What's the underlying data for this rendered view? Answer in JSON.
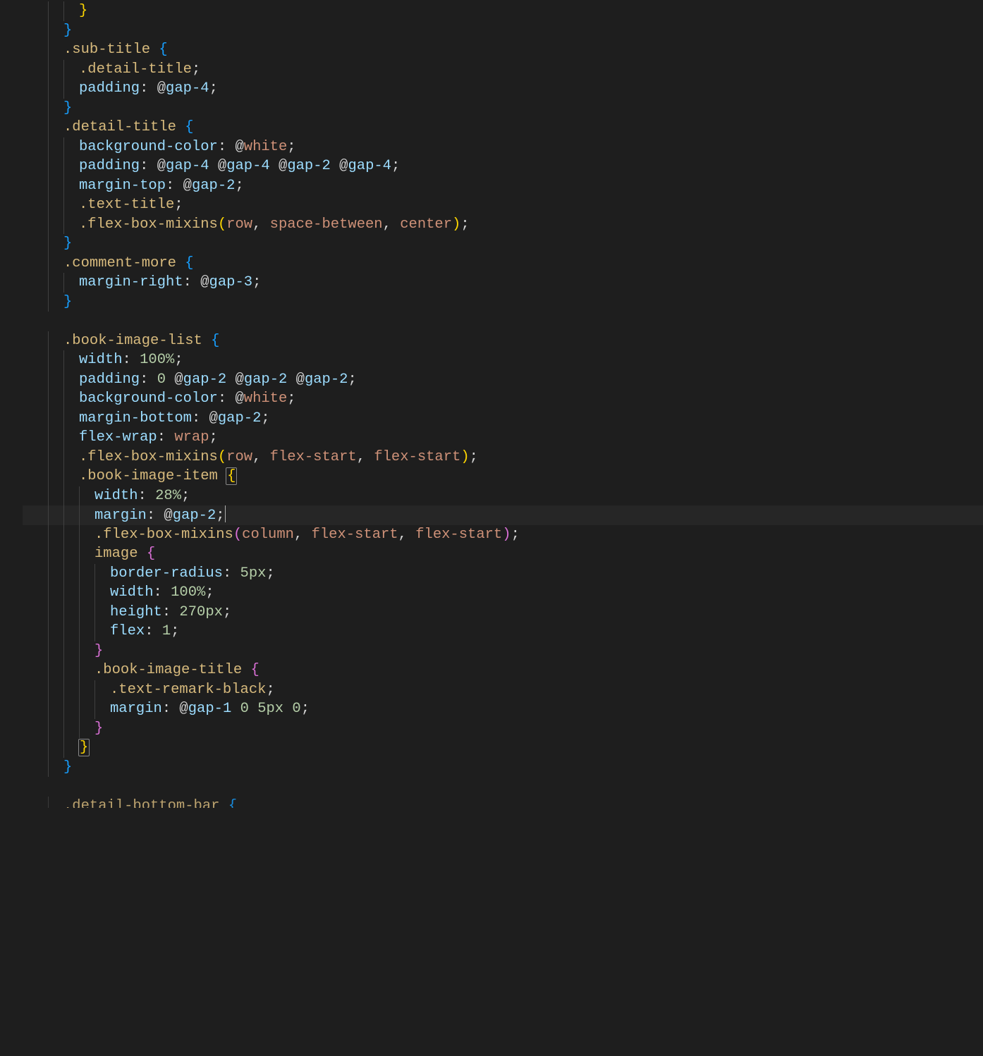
{
  "editor": {
    "theme": "dark",
    "language": "less",
    "visible_line_count": 42,
    "active_line_index": 26,
    "gutter_start_partial": true,
    "indent_size": 2,
    "indent_guides": true,
    "lines": [
      {
        "indent": 3,
        "tokens": [
          {
            "t": "brace3",
            "v": "}"
          }
        ]
      },
      {
        "indent": 2,
        "tokens": [
          {
            "t": "brace2",
            "v": "}"
          }
        ]
      },
      {
        "indent": 2,
        "tokens": [
          {
            "t": "sel",
            "v": ".sub-title"
          },
          {
            "t": "punct",
            "v": " "
          },
          {
            "t": "brace2",
            "v": "{"
          }
        ]
      },
      {
        "indent": 3,
        "tokens": [
          {
            "t": "sel",
            "v": ".detail-title"
          },
          {
            "t": "punct",
            "v": ";"
          }
        ]
      },
      {
        "indent": 3,
        "tokens": [
          {
            "t": "prop",
            "v": "padding"
          },
          {
            "t": "punct",
            "v": ": "
          },
          {
            "t": "at",
            "v": "@"
          },
          {
            "t": "var",
            "v": "gap-4"
          },
          {
            "t": "punct",
            "v": ";"
          }
        ]
      },
      {
        "indent": 2,
        "tokens": [
          {
            "t": "brace2",
            "v": "}"
          }
        ]
      },
      {
        "indent": 2,
        "tokens": [
          {
            "t": "sel",
            "v": ".detail-title"
          },
          {
            "t": "punct",
            "v": " "
          },
          {
            "t": "brace2",
            "v": "{"
          }
        ]
      },
      {
        "indent": 3,
        "tokens": [
          {
            "t": "prop",
            "v": "background-color"
          },
          {
            "t": "punct",
            "v": ": "
          },
          {
            "t": "at",
            "v": "@"
          },
          {
            "t": "white",
            "v": "white"
          },
          {
            "t": "punct",
            "v": ";"
          }
        ]
      },
      {
        "indent": 3,
        "tokens": [
          {
            "t": "prop",
            "v": "padding"
          },
          {
            "t": "punct",
            "v": ": "
          },
          {
            "t": "at",
            "v": "@"
          },
          {
            "t": "var",
            "v": "gap-4"
          },
          {
            "t": "punct",
            "v": " "
          },
          {
            "t": "at",
            "v": "@"
          },
          {
            "t": "var",
            "v": "gap-4"
          },
          {
            "t": "punct",
            "v": " "
          },
          {
            "t": "at",
            "v": "@"
          },
          {
            "t": "var",
            "v": "gap-2"
          },
          {
            "t": "punct",
            "v": " "
          },
          {
            "t": "at",
            "v": "@"
          },
          {
            "t": "var",
            "v": "gap-4"
          },
          {
            "t": "punct",
            "v": ";"
          }
        ]
      },
      {
        "indent": 3,
        "tokens": [
          {
            "t": "prop",
            "v": "margin-top"
          },
          {
            "t": "punct",
            "v": ": "
          },
          {
            "t": "at",
            "v": "@"
          },
          {
            "t": "var",
            "v": "gap-2"
          },
          {
            "t": "punct",
            "v": ";"
          }
        ]
      },
      {
        "indent": 3,
        "tokens": [
          {
            "t": "sel",
            "v": ".text-title"
          },
          {
            "t": "punct",
            "v": ";"
          }
        ]
      },
      {
        "indent": 3,
        "tokens": [
          {
            "t": "mix",
            "v": ".flex-box-mixins"
          },
          {
            "t": "paren",
            "v": "("
          },
          {
            "t": "kw",
            "v": "row"
          },
          {
            "t": "punct",
            "v": ", "
          },
          {
            "t": "kw",
            "v": "space-between"
          },
          {
            "t": "punct",
            "v": ", "
          },
          {
            "t": "kw",
            "v": "center"
          },
          {
            "t": "paren",
            "v": ")"
          },
          {
            "t": "punct",
            "v": ";"
          }
        ]
      },
      {
        "indent": 2,
        "tokens": [
          {
            "t": "brace2",
            "v": "}"
          }
        ]
      },
      {
        "indent": 2,
        "tokens": [
          {
            "t": "sel",
            "v": ".comment-more"
          },
          {
            "t": "punct",
            "v": " "
          },
          {
            "t": "brace2",
            "v": "{"
          }
        ]
      },
      {
        "indent": 3,
        "tokens": [
          {
            "t": "prop",
            "v": "margin-right"
          },
          {
            "t": "punct",
            "v": ": "
          },
          {
            "t": "at",
            "v": "@"
          },
          {
            "t": "var",
            "v": "gap-3"
          },
          {
            "t": "punct",
            "v": ";"
          }
        ]
      },
      {
        "indent": 2,
        "tokens": [
          {
            "t": "brace2",
            "v": "}"
          }
        ]
      },
      {
        "indent": 0,
        "tokens": []
      },
      {
        "indent": 2,
        "tokens": [
          {
            "t": "sel",
            "v": ".book-image-list"
          },
          {
            "t": "punct",
            "v": " "
          },
          {
            "t": "brace2",
            "v": "{"
          }
        ]
      },
      {
        "indent": 3,
        "tokens": [
          {
            "t": "prop",
            "v": "width"
          },
          {
            "t": "punct",
            "v": ": "
          },
          {
            "t": "num",
            "v": "100"
          },
          {
            "t": "unit",
            "v": "%"
          },
          {
            "t": "punct",
            "v": ";"
          }
        ]
      },
      {
        "indent": 3,
        "tokens": [
          {
            "t": "prop",
            "v": "padding"
          },
          {
            "t": "punct",
            "v": ": "
          },
          {
            "t": "num",
            "v": "0"
          },
          {
            "t": "punct",
            "v": " "
          },
          {
            "t": "at",
            "v": "@"
          },
          {
            "t": "var",
            "v": "gap-2"
          },
          {
            "t": "punct",
            "v": " "
          },
          {
            "t": "at",
            "v": "@"
          },
          {
            "t": "var",
            "v": "gap-2"
          },
          {
            "t": "punct",
            "v": " "
          },
          {
            "t": "at",
            "v": "@"
          },
          {
            "t": "var",
            "v": "gap-2"
          },
          {
            "t": "punct",
            "v": ";"
          }
        ]
      },
      {
        "indent": 3,
        "tokens": [
          {
            "t": "prop",
            "v": "background-color"
          },
          {
            "t": "punct",
            "v": ": "
          },
          {
            "t": "at",
            "v": "@"
          },
          {
            "t": "white",
            "v": "white"
          },
          {
            "t": "punct",
            "v": ";"
          }
        ]
      },
      {
        "indent": 3,
        "tokens": [
          {
            "t": "prop",
            "v": "margin-bottom"
          },
          {
            "t": "punct",
            "v": ": "
          },
          {
            "t": "at",
            "v": "@"
          },
          {
            "t": "var",
            "v": "gap-2"
          },
          {
            "t": "punct",
            "v": ";"
          }
        ]
      },
      {
        "indent": 3,
        "tokens": [
          {
            "t": "prop",
            "v": "flex-wrap"
          },
          {
            "t": "punct",
            "v": ": "
          },
          {
            "t": "kw",
            "v": "wrap"
          },
          {
            "t": "punct",
            "v": ";"
          }
        ]
      },
      {
        "indent": 3,
        "tokens": [
          {
            "t": "mix",
            "v": ".flex-box-mixins"
          },
          {
            "t": "paren",
            "v": "("
          },
          {
            "t": "kw",
            "v": "row"
          },
          {
            "t": "punct",
            "v": ", "
          },
          {
            "t": "kw",
            "v": "flex-start"
          },
          {
            "t": "punct",
            "v": ", "
          },
          {
            "t": "kw",
            "v": "flex-start"
          },
          {
            "t": "paren",
            "v": ")"
          },
          {
            "t": "punct",
            "v": ";"
          }
        ]
      },
      {
        "indent": 3,
        "tokens": [
          {
            "t": "sel",
            "v": ".book-image-item"
          },
          {
            "t": "punct",
            "v": " "
          },
          {
            "t": "brace3",
            "v": "{",
            "match": true
          }
        ]
      },
      {
        "indent": 4,
        "tokens": [
          {
            "t": "prop",
            "v": "width"
          },
          {
            "t": "punct",
            "v": ": "
          },
          {
            "t": "num",
            "v": "28"
          },
          {
            "t": "unit",
            "v": "%"
          },
          {
            "t": "punct",
            "v": ";"
          }
        ]
      },
      {
        "indent": 4,
        "active": true,
        "tokens": [
          {
            "t": "prop",
            "v": "margin"
          },
          {
            "t": "punct",
            "v": ": "
          },
          {
            "t": "at",
            "v": "@"
          },
          {
            "t": "var",
            "v": "gap-2"
          },
          {
            "t": "punct",
            "v": ";"
          },
          {
            "t": "cursor",
            "v": ""
          }
        ]
      },
      {
        "indent": 4,
        "tokens": [
          {
            "t": "mix",
            "v": ".flex-box-mixins"
          },
          {
            "t": "paren2",
            "v": "("
          },
          {
            "t": "kw",
            "v": "column"
          },
          {
            "t": "punct",
            "v": ", "
          },
          {
            "t": "kw",
            "v": "flex-start"
          },
          {
            "t": "punct",
            "v": ", "
          },
          {
            "t": "kw",
            "v": "flex-start"
          },
          {
            "t": "paren2",
            "v": ")"
          },
          {
            "t": "punct",
            "v": ";"
          }
        ]
      },
      {
        "indent": 4,
        "tokens": [
          {
            "t": "sel",
            "v": "image"
          },
          {
            "t": "punct",
            "v": " "
          },
          {
            "t": "brace",
            "v": "{"
          }
        ]
      },
      {
        "indent": 5,
        "tokens": [
          {
            "t": "prop",
            "v": "border-radius"
          },
          {
            "t": "punct",
            "v": ": "
          },
          {
            "t": "num",
            "v": "5"
          },
          {
            "t": "unit",
            "v": "px"
          },
          {
            "t": "punct",
            "v": ";"
          }
        ]
      },
      {
        "indent": 5,
        "tokens": [
          {
            "t": "prop",
            "v": "width"
          },
          {
            "t": "punct",
            "v": ": "
          },
          {
            "t": "num",
            "v": "100"
          },
          {
            "t": "unit",
            "v": "%"
          },
          {
            "t": "punct",
            "v": ";"
          }
        ]
      },
      {
        "indent": 5,
        "tokens": [
          {
            "t": "prop",
            "v": "height"
          },
          {
            "t": "punct",
            "v": ": "
          },
          {
            "t": "num",
            "v": "270"
          },
          {
            "t": "unit",
            "v": "px"
          },
          {
            "t": "punct",
            "v": ";"
          }
        ]
      },
      {
        "indent": 5,
        "tokens": [
          {
            "t": "prop",
            "v": "flex"
          },
          {
            "t": "punct",
            "v": ": "
          },
          {
            "t": "num",
            "v": "1"
          },
          {
            "t": "punct",
            "v": ";"
          }
        ]
      },
      {
        "indent": 4,
        "tokens": [
          {
            "t": "brace",
            "v": "}"
          }
        ]
      },
      {
        "indent": 4,
        "tokens": [
          {
            "t": "sel",
            "v": ".book-image-title"
          },
          {
            "t": "punct",
            "v": " "
          },
          {
            "t": "brace",
            "v": "{"
          }
        ]
      },
      {
        "indent": 5,
        "tokens": [
          {
            "t": "sel",
            "v": ".text-remark-black"
          },
          {
            "t": "punct",
            "v": ";"
          }
        ]
      },
      {
        "indent": 5,
        "tokens": [
          {
            "t": "prop",
            "v": "margin"
          },
          {
            "t": "punct",
            "v": ": "
          },
          {
            "t": "at",
            "v": "@"
          },
          {
            "t": "var",
            "v": "gap-1"
          },
          {
            "t": "punct",
            "v": " "
          },
          {
            "t": "num",
            "v": "0"
          },
          {
            "t": "punct",
            "v": " "
          },
          {
            "t": "num",
            "v": "5"
          },
          {
            "t": "unit",
            "v": "px"
          },
          {
            "t": "punct",
            "v": " "
          },
          {
            "t": "num",
            "v": "0"
          },
          {
            "t": "punct",
            "v": ";"
          }
        ]
      },
      {
        "indent": 4,
        "tokens": [
          {
            "t": "brace",
            "v": "}"
          }
        ]
      },
      {
        "indent": 3,
        "tokens": [
          {
            "t": "brace3",
            "v": "}",
            "match": true
          }
        ]
      },
      {
        "indent": 2,
        "tokens": [
          {
            "t": "brace2",
            "v": "}"
          }
        ]
      },
      {
        "indent": 0,
        "tokens": []
      },
      {
        "indent": 2,
        "cut": true,
        "tokens": [
          {
            "t": "sel",
            "v": ".detail-bottom-bar"
          },
          {
            "t": "punct",
            "v": " "
          },
          {
            "t": "brace2",
            "v": "{"
          }
        ]
      }
    ]
  }
}
